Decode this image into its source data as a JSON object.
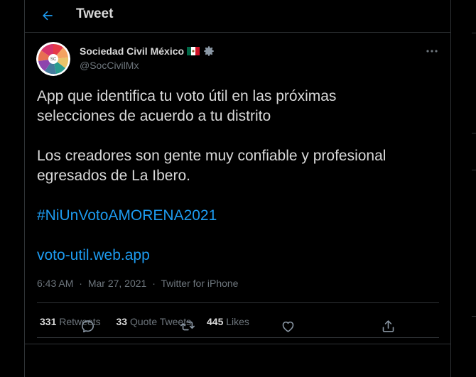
{
  "header": {
    "title": "Tweet",
    "back_icon": "arrow-left-icon"
  },
  "author": {
    "name": "Sociedad Civil México",
    "handle": "@SocCivilMx",
    "flag_icon": "mexico-flag-icon",
    "badge_icon": "gear-icon"
  },
  "tweet": {
    "line1": "App que identifica tu voto útil en las próximas",
    "line2": "selecciones de acuerdo a tu distrito",
    "line3": "Los creadores son gente muy confiable y profesional",
    "line4": "egresados de La Ibero.",
    "hashtag": "#NiUnVotoAMORENA2021",
    "link": "voto-util.web.app",
    "time": "6:43 AM",
    "date": "Mar 27, 2021",
    "source": "Twitter for iPhone",
    "separator": "·"
  },
  "stats": {
    "retweets_count": "331",
    "retweets_label": "Retweets",
    "quotes_count": "33",
    "quotes_label": "Quote Tweets",
    "likes_count": "445",
    "likes_label": "Likes"
  },
  "actions": [
    "reply-icon",
    "retweet-icon",
    "like-icon",
    "share-icon"
  ],
  "colors": {
    "background": "#000000",
    "text": "#d9d9d9",
    "muted": "#6e767d",
    "accent": "#1d9bf0",
    "border": "#2f3336"
  }
}
